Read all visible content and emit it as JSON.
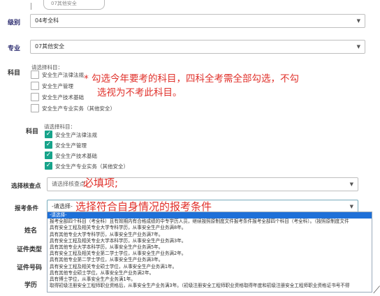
{
  "top_field": {
    "value": "07其他安全"
  },
  "level": {
    "label": "级别",
    "value": "04考全科"
  },
  "major": {
    "label": "专业",
    "value": "07其他安全"
  },
  "subjects_unchecked": {
    "label": "科目",
    "hint": "请选择科目：",
    "options": [
      "安全生产法律法规",
      "安全生产管理",
      "安全生产技术基础",
      "安全生产专业实务（其他安全）"
    ]
  },
  "subjects_checked": {
    "label": "科目",
    "hint": "请选择科目：",
    "options": [
      "安全生产法律法规",
      "安全生产管理",
      "安全生产技术基础",
      "安全生产专业实务（其他安全）"
    ]
  },
  "annotations": {
    "subjects_note_line1": "* 勾选今年要考的科目，四科全考需全部勾选，不勾",
    "subjects_note_line2": "选视为不考此科目。",
    "exam_point_note": "必填项;",
    "condition_note": "选择符合自身情况的报考条件"
  },
  "exam_point": {
    "label": "选择核查点",
    "placeholder": "请选择核查点"
  },
  "condition": {
    "label": "报考条件",
    "placeholder": "-请选择-",
    "options": [
      "-请选择-",
      "报考全部四个科目（考全科）且有效期内有合格成绩的中专学历人员，继续按照原制度文件报考条件报考全部四个科目（考全科）。（按照原制度文件",
      "具有安全工程及相关专业大学专科学历，从事安全生产业务满8年。",
      "具有其他专业大学专科学历，从事安全生产业务满7年。",
      "具有安全工程及相关专业大学本科学历，从事安全生产业务满3年。",
      "具有其他专业大学本科学历，从事安全生产业务满5年。",
      "具有安全工程及相关专业第二学士学位，从事安全生产业务满2年。",
      "具有其他专业第二学士学位，从事安全生产业务满3年。",
      "具有安全工程及相关专业硕士学位，从事安全生产业务满1年。",
      "具有其他专业硕士学位，从事安全生产业务满2年。",
      "具有博士学位，从事安全生产业务满1年。",
      "取得初级注册安全工程师职业资格后，从事安全生产业务满3年。（初级注册安全工程师职业资格取得年度和初级注册安全工程师职业资格证书号不得"
    ]
  },
  "side_labels": {
    "name": "姓名",
    "id_type": "证件类型",
    "id_number": "证件号码",
    "education": "学历"
  }
}
